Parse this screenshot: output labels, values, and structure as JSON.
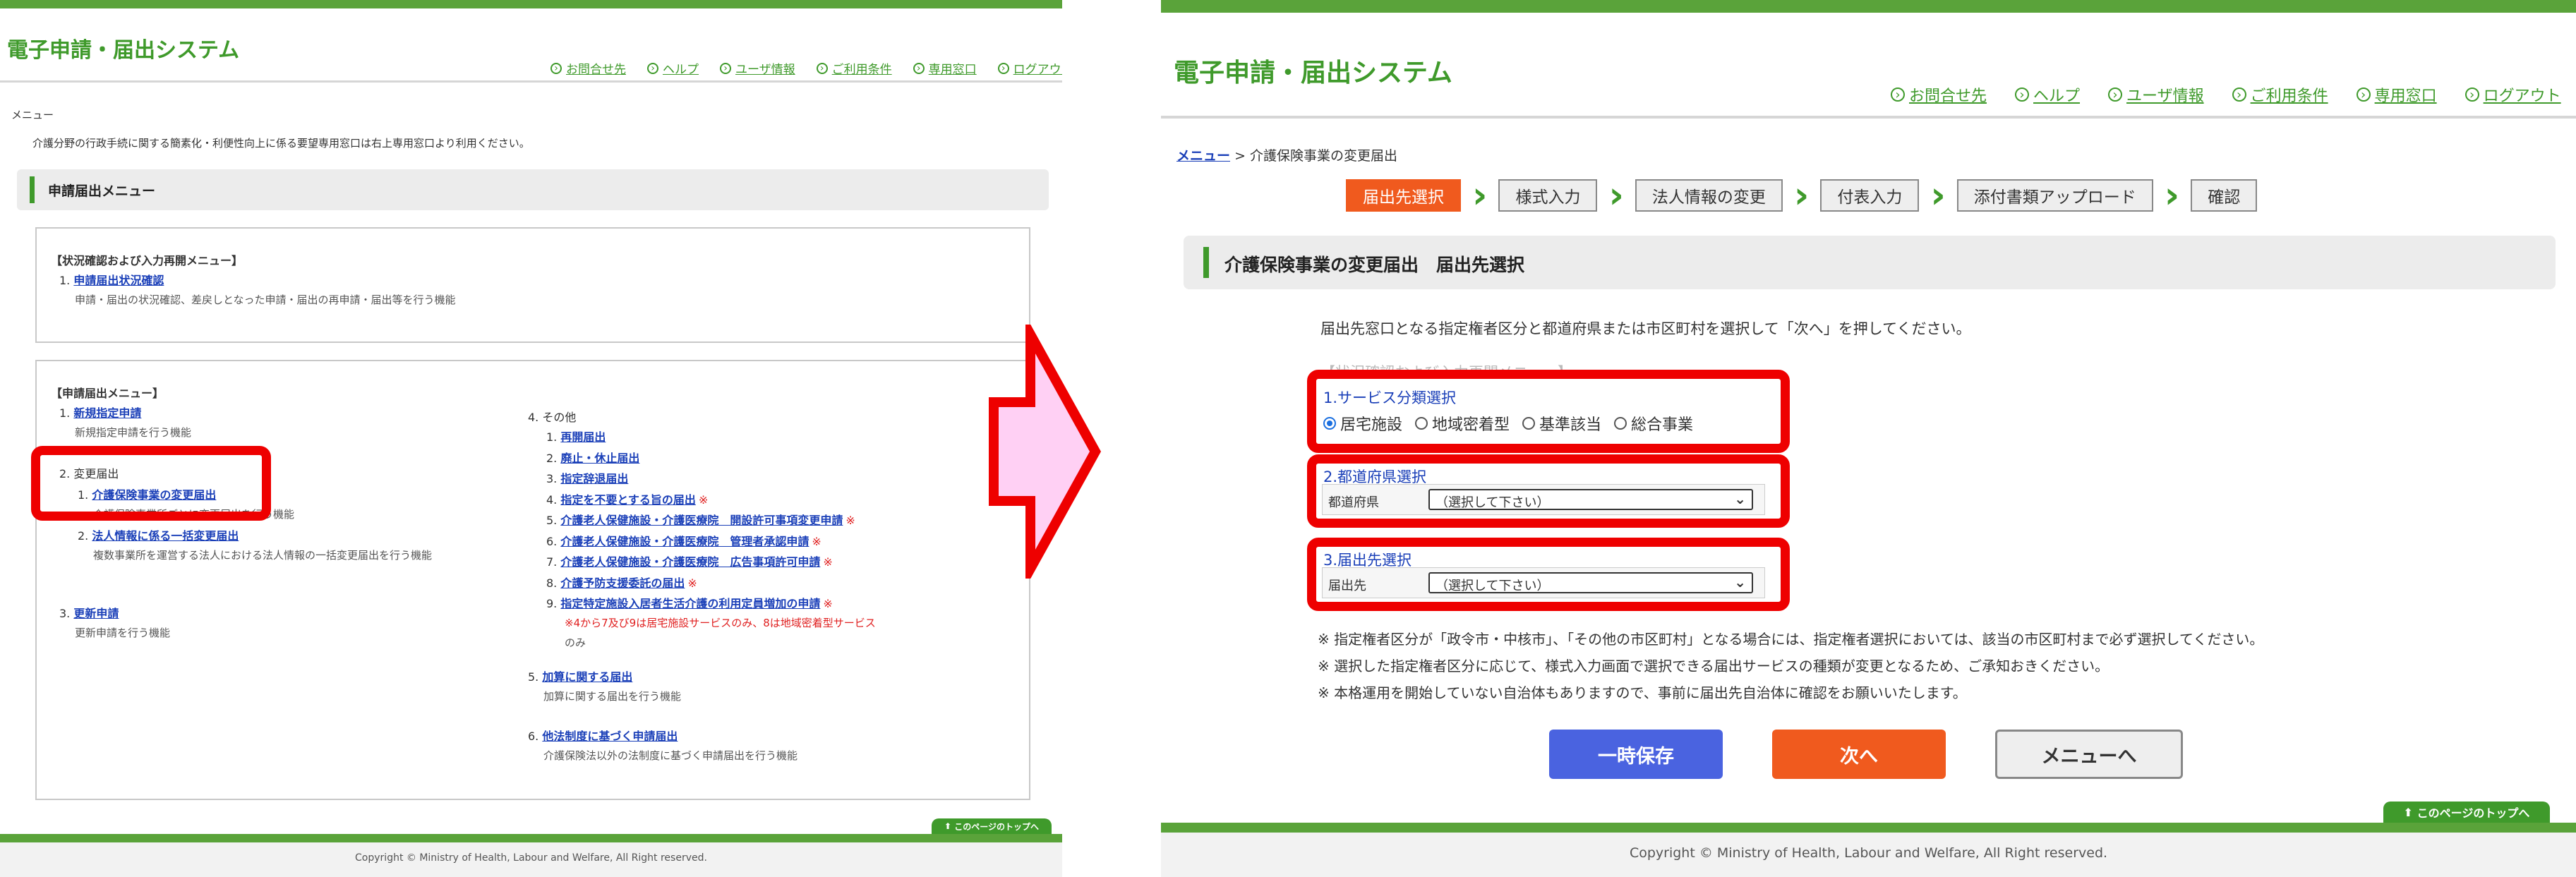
{
  "app_title": "電子申請・届出システム",
  "header_links": [
    "お問合せ先",
    "ヘルプ",
    "ユーザ情報",
    "ご利用条件",
    "専用窓口",
    "ログアウト"
  ],
  "copyright": "Copyright © Ministry of Health, Labour and Welfare, All Right reserved.",
  "page_top": "このページのトップへ",
  "left": {
    "breadcrumb": "メニュー",
    "intro": "介護分野の行政手続に関する簡素化・利便性向上に係る要望専用窓口は右上専用窓口より利用ください。",
    "section_title": "申請届出メニュー",
    "status_box": {
      "title": "【状況確認および入力再開メニュー】",
      "item_num": "1.",
      "item_link": "申請届出状況確認",
      "item_desc": "申請・届出の状況確認、差戻しとなった申請・届出の再申請・届出等を行う機能"
    },
    "menu_title": "【申請届出メニュー】",
    "c1": {
      "n1": "1.",
      "l1": "新規指定申請",
      "d1": "新規指定申請を行う機能",
      "n2": "2.",
      "t2": "変更届出",
      "s1n": "1.",
      "s1l": "介護保険事業の変更届出",
      "s1d": "介護保険事業所ごとに変更届出を行う機能",
      "s2n": "2.",
      "s2l": "法人情報に係る一括変更届出",
      "s2d": "複数事業所を運営する法人における法人情報の一括変更届出を行う機能",
      "n3": "3.",
      "l3": "更新申請",
      "d3": "更新申請を行う機能"
    },
    "c2": {
      "n4": "4.",
      "t4": "その他",
      "subs": [
        {
          "n": "1.",
          "l": "再開届出",
          "m": ""
        },
        {
          "n": "2.",
          "l": "廃止・休止届出",
          "m": ""
        },
        {
          "n": "3.",
          "l": "指定辞退届出",
          "m": ""
        },
        {
          "n": "4.",
          "l": "指定を不要とする旨の届出",
          "m": "※"
        },
        {
          "n": "5.",
          "l": "介護老人保健施設・介護医療院　開設許可事項変更申請",
          "m": "※"
        },
        {
          "n": "6.",
          "l": "介護老人保健施設・介護医療院　管理者承認申請",
          "m": "※"
        },
        {
          "n": "7.",
          "l": "介護老人保健施設・介護医療院　広告事項許可申請",
          "m": "※"
        },
        {
          "n": "8.",
          "l": "介護予防支援委託の届出",
          "m": "※"
        },
        {
          "n": "9.",
          "l": "指定特定施設入居者生活介護の利用定員増加の申請",
          "m": "※"
        }
      ],
      "note1": "※4から7及び9は居宅施設サービスのみ、8は地域密着型サービス",
      "note2": "のみ",
      "n5": "5.",
      "l5": "加算に関する届出",
      "d5": "加算に関する届出を行う機能",
      "n6": "6.",
      "l6": "他法制度に基づく申請届出",
      "d6": "介護保険法以外の法制度に基づく申請届出を行う機能"
    }
  },
  "right": {
    "breadcrumb_link": "メニュー",
    "breadcrumb_sep": ">",
    "breadcrumb_current": "介護保険事業の変更届出",
    "steps": [
      "届出先選択",
      "様式入力",
      "法人情報の変更",
      "付表入力",
      "添付書類アップロード",
      "確認"
    ],
    "section_title": "介護保険事業の変更届出　届出先選択",
    "instruction": "届出先窓口となる指定権者区分と都道府県または市区町村を選択して「次へ」を押してください。",
    "ghost_text": "【状況確認および入力再開メニュー】",
    "service": {
      "label": "1.サービス分類選択",
      "options": [
        "居宅施設",
        "地域密着型",
        "基準該当",
        "総合事業"
      ],
      "selected": "居宅施設"
    },
    "pref": {
      "label": "2.都道府県選択",
      "field": "都道府県",
      "value": "（選択して下さい）"
    },
    "dest": {
      "label": "3.届出先選択",
      "field": "届出先",
      "value": "（選択して下さい）"
    },
    "notes": [
      "※ 指定権者区分が「政令市・中核市」、「その他の市区町村」となる場合には、指定権者選択においては、該当の市区町村まで必ず選択してください。",
      "※ 選択した指定権者区分に応じて、様式入力画面で選択できる届出サービスの種類が変更となるため、ご承知おきください。",
      "※ 本格運用を開始していない自治体もありますので、事前に届出先自治体に確認をお願いいたします。"
    ],
    "buttons": {
      "save": "一時保存",
      "next": "次へ",
      "menu": "メニューへ"
    }
  },
  "colors": {
    "brand_green": "#3f9a2b",
    "active_step": "#f05a1e",
    "save_button": "#4a63e0",
    "next_button": "#f05a1e",
    "highlight_red": "#ee0000",
    "arrow_fill": "#ffd0f4"
  }
}
